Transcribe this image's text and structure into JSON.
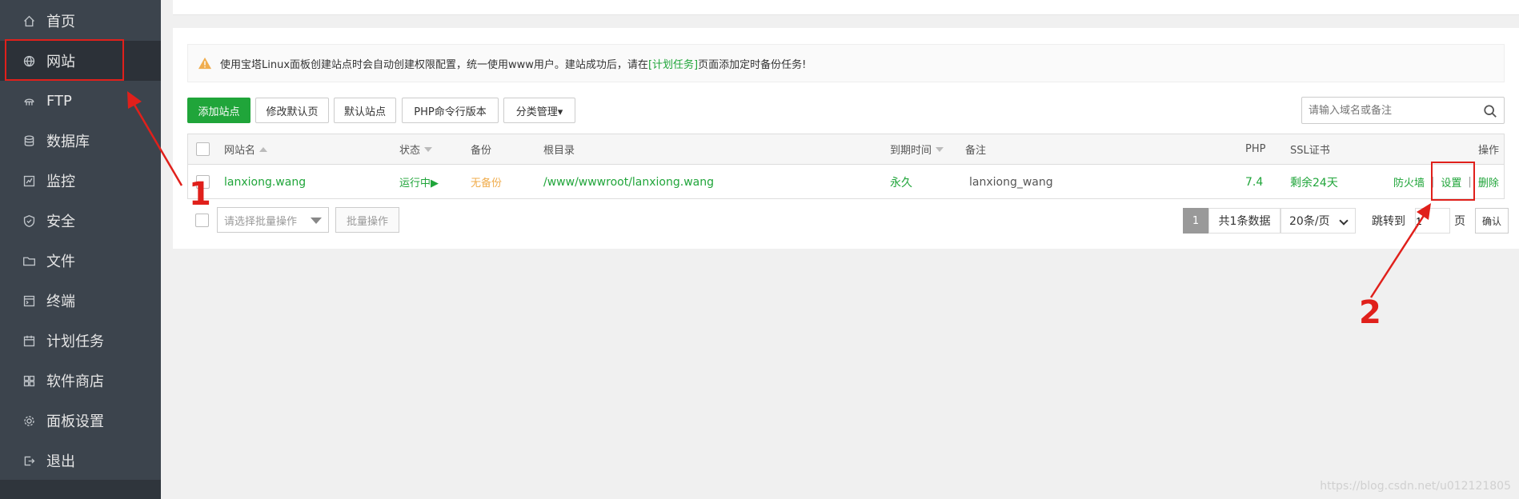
{
  "sidebar": {
    "items": [
      {
        "label": "首页",
        "icon": "home-icon"
      },
      {
        "label": "网站",
        "icon": "globe-icon"
      },
      {
        "label": "FTP",
        "icon": "ftp-icon"
      },
      {
        "label": "数据库",
        "icon": "database-icon"
      },
      {
        "label": "监控",
        "icon": "monitor-icon"
      },
      {
        "label": "安全",
        "icon": "shield-icon"
      },
      {
        "label": "文件",
        "icon": "folder-icon"
      },
      {
        "label": "终端",
        "icon": "terminal-icon"
      },
      {
        "label": "计划任务",
        "icon": "calendar-icon"
      },
      {
        "label": "软件商店",
        "icon": "grid-icon"
      },
      {
        "label": "面板设置",
        "icon": "gear-icon"
      },
      {
        "label": "退出",
        "icon": "logout-icon"
      }
    ],
    "active_index": 1
  },
  "notice": {
    "text_before": "使用宝塔Linux面板创建站点时会自动创建权限配置，统一使用www用户。建站成功后，请在",
    "link": "[计划任务]",
    "text_after": "页面添加定时备份任务!"
  },
  "toolbar": {
    "add_site": "添加站点",
    "edit_default_page": "修改默认页",
    "default_site": "默认站点",
    "php_cli": "PHP命令行版本",
    "category_manage": "分类管理▾",
    "search_placeholder": "请输入域名或备注"
  },
  "table": {
    "headers": {
      "name": "网站名",
      "status": "状态",
      "backup": "备份",
      "root": "根目录",
      "expire": "到期时间",
      "remark": "备注",
      "php": "PHP",
      "ssl": "SSL证书",
      "actions": "操作"
    },
    "rows": [
      {
        "name": "lanxiong.wang",
        "status": "运行中▶",
        "backup": "无备份",
        "root": "/www/wwwroot/lanxiong.wang",
        "expire": "永久",
        "remark": "lanxiong_wang",
        "php": "7.4",
        "ssl": "剩余24天",
        "action_firewall": "防火墙",
        "action_settings": "设置",
        "action_delete": "删除"
      }
    ]
  },
  "footer": {
    "batch_placeholder": "请选择批量操作",
    "batch_button": "批量操作",
    "current_page": "1",
    "total": "共1条数据",
    "page_size": "20条/页",
    "jump_label": "跳转到",
    "jump_value": "1",
    "page_unit": "页",
    "confirm": "确认"
  },
  "annotations": {
    "label_1": "1",
    "label_2": "2"
  },
  "watermark": "https://blog.csdn.net/u012121805",
  "colors": {
    "accent_green": "#20a53a",
    "sidebar_bg": "#3c444d",
    "warning_orange": "#f0ad4e",
    "annotation_red": "#e0201b"
  }
}
